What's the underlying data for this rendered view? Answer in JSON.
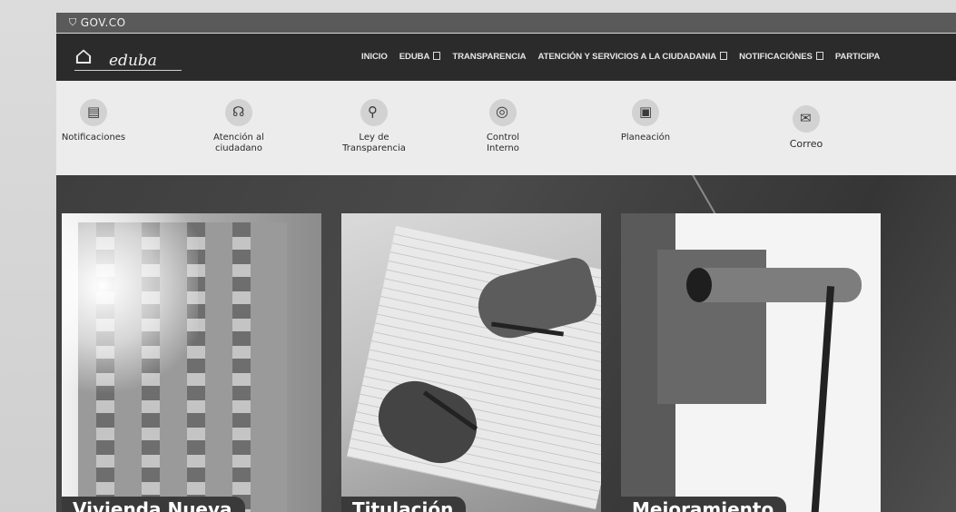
{
  "gov": {
    "brand": "GOV.CO",
    "shield": "⛉"
  },
  "logo": {
    "mark": "⌂",
    "name": "eduba"
  },
  "nav": {
    "items": [
      {
        "label": "INICIO",
        "dropdown": false
      },
      {
        "label": "EDUBA",
        "dropdown": true
      },
      {
        "label": "TRANSPARENCIA",
        "dropdown": false
      },
      {
        "label": "ATENCIÓN Y SERVICIOS A LA CIUDADANIA",
        "dropdown": true
      },
      {
        "label": "NOTIFICACIÓNES",
        "dropdown": true
      },
      {
        "label": "PARTICIPA",
        "dropdown": false
      }
    ]
  },
  "quick_links": [
    {
      "label": "Notificaciones",
      "icon": "notifications-icon",
      "glyph": "▤"
    },
    {
      "label": "Atención al\nciudadano",
      "icon": "headset-icon",
      "glyph": "☊"
    },
    {
      "label": "Ley de\nTransparencia",
      "icon": "magnifier-icon",
      "glyph": "⚲"
    },
    {
      "label": "Control\nInterno",
      "icon": "gear-target-icon",
      "glyph": "◎"
    },
    {
      "label": "Planeación",
      "icon": "planning-icon",
      "glyph": "▣"
    },
    {
      "label": "Correo",
      "icon": "mail-icon",
      "glyph": "✉"
    }
  ],
  "cards": [
    {
      "title": "Vivienda Nueva"
    },
    {
      "title": "Titulación"
    },
    {
      "title": "Mejoramiento"
    }
  ]
}
